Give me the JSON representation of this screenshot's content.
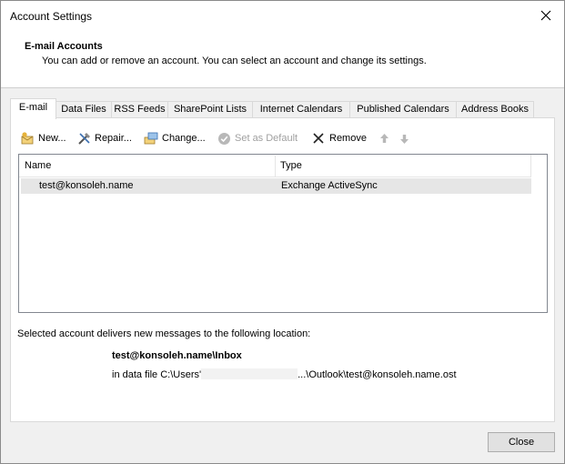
{
  "window": {
    "title": "Account Settings"
  },
  "header": {
    "title": "E-mail Accounts",
    "description": "You can add or remove an account. You can select an account and change its settings."
  },
  "tabs": [
    {
      "label": "E-mail",
      "active": true
    },
    {
      "label": "Data Files"
    },
    {
      "label": "RSS Feeds"
    },
    {
      "label": "SharePoint Lists"
    },
    {
      "label": "Internet Calendars"
    },
    {
      "label": "Published Calendars"
    },
    {
      "label": "Address Books"
    }
  ],
  "toolbar": {
    "new_label": "New...",
    "repair_label": "Repair...",
    "change_label": "Change...",
    "default_label": "Set as Default",
    "remove_label": "Remove"
  },
  "list": {
    "headers": {
      "name": "Name",
      "type": "Type"
    },
    "rows": [
      {
        "name": "test@konsoleh.name",
        "type": "Exchange ActiveSync"
      }
    ]
  },
  "delivery": {
    "text": "Selected account delivers new messages to the following location:",
    "location": "test@konsoleh.name\\Inbox",
    "file_prefix": "in data file C:\\Users'",
    "file_suffix": "...\\Outlook\\test@konsoleh.name.ost"
  },
  "footer": {
    "close_label": "Close"
  },
  "colors": {
    "accent_blue": "#1e66c8",
    "disabled_gray": "#a0a0a0"
  }
}
